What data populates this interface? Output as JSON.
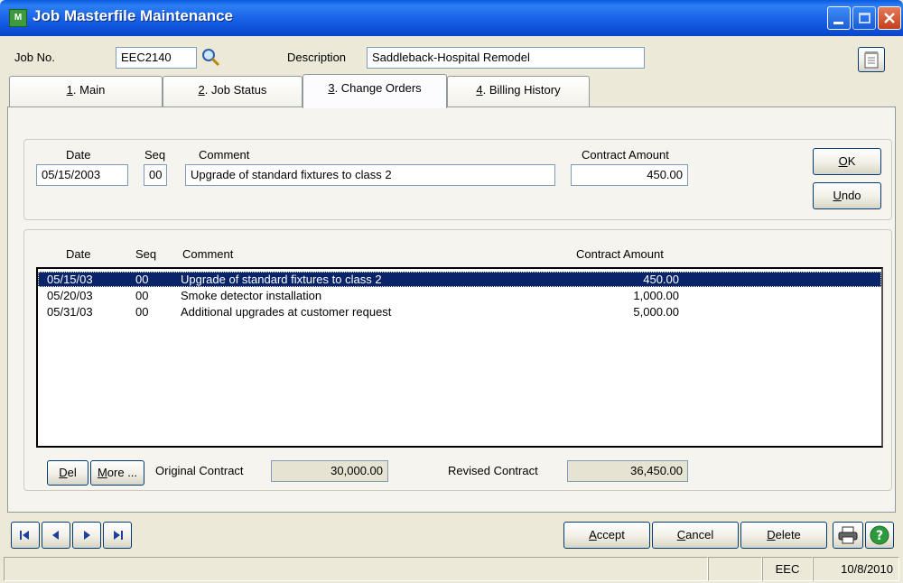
{
  "window": {
    "title": "Job Masterfile Maintenance",
    "icon_label": "M"
  },
  "header": {
    "job_no_label": "Job No.",
    "job_no_value": "EEC2140",
    "description_label": "Description",
    "description_value": "Saddleback-Hospital Remodel"
  },
  "tabs": [
    {
      "key": "1",
      "rest": ". Main"
    },
    {
      "key": "2",
      "rest": ". Job Status"
    },
    {
      "key": "3",
      "rest": ". Change Orders"
    },
    {
      "key": "4",
      "rest": ". Billing History"
    }
  ],
  "entry": {
    "date_label": "Date",
    "seq_label": "Seq",
    "comment_label": "Comment",
    "amount_label": "Contract Amount",
    "date_value": "05/15/2003",
    "seq_value": "00",
    "comment_value": "Upgrade of standard fixtures to class 2",
    "amount_value": "450.00",
    "ok_key": "O",
    "ok_rest": "K",
    "undo_key": "U",
    "undo_rest": "ndo"
  },
  "list": {
    "columns": [
      "Date",
      "Seq",
      "Comment",
      "Contract Amount"
    ],
    "rows": [
      {
        "date": "05/15/03",
        "seq": "00",
        "comment": "Upgrade of standard fixtures to class 2",
        "amount": "450.00"
      },
      {
        "date": "05/20/03",
        "seq": "00",
        "comment": "Smoke detector installation",
        "amount": "1,000.00"
      },
      {
        "date": "05/31/03",
        "seq": "00",
        "comment": "Additional upgrades at customer request",
        "amount": "5,000.00"
      }
    ]
  },
  "totals": {
    "del_key": "D",
    "del_rest": "el",
    "more_key": "M",
    "more_rest": "ore ...",
    "original_label": "Original Contract",
    "original_value": "30,000.00",
    "revised_label": "Revised Contract",
    "revised_value": "36,450.00"
  },
  "actions": {
    "accept_key": "A",
    "accept_rest": "ccept",
    "cancel_key": "C",
    "cancel_rest": "ancel",
    "delete_key": "D",
    "delete_rest": "elete"
  },
  "status": {
    "company": "EEC",
    "date": "10/8/2010"
  },
  "icons": {
    "lookup": "magnifier-icon",
    "notes": "notepad-icon",
    "print": "printer-icon",
    "help": "help-icon",
    "nav": [
      "first-record-icon",
      "previous-record-icon",
      "next-record-icon",
      "last-record-icon"
    ]
  },
  "colors": {
    "titlebar": "#0a5ae0",
    "selection": "#0a246a",
    "window_bg": "#ece9d8"
  }
}
